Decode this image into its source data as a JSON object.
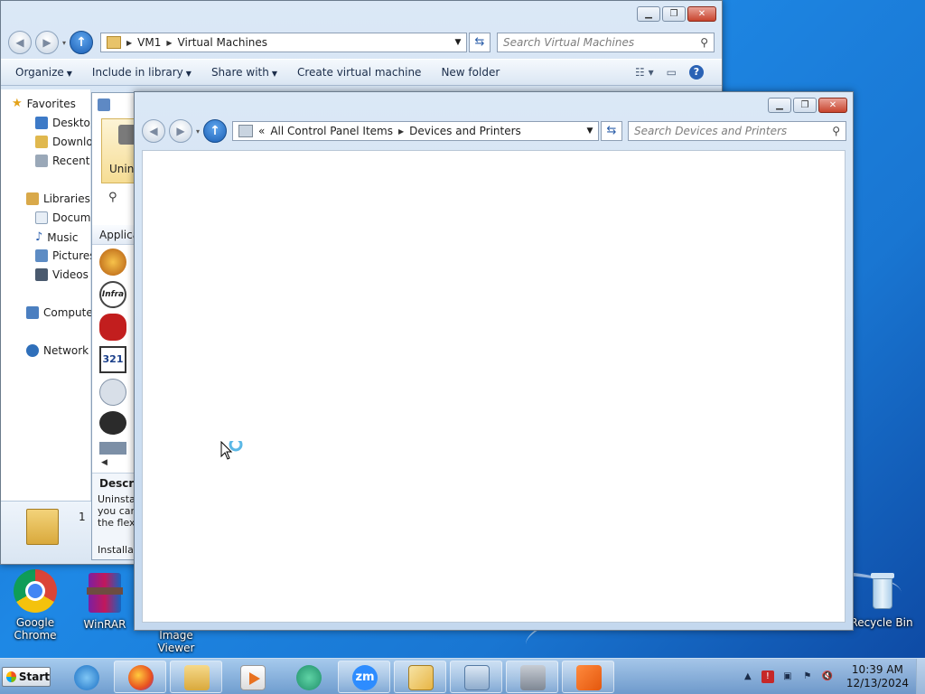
{
  "explorer": {
    "breadcrumb": [
      "VM1",
      "Virtual Machines"
    ],
    "search_placeholder": "Search Virtual Machines",
    "toolbar": {
      "organize": "Organize",
      "include_in_library": "Include in library",
      "share_with": "Share with",
      "create_vm": "Create virtual machine",
      "new_folder": "New folder"
    },
    "nav": {
      "favorites": "Favorites",
      "desktop": "Desktop",
      "downloads": "Downlo",
      "recent": "Recent P",
      "libraries": "Libraries",
      "documents": "Docume",
      "music": "Music",
      "pictures": "Pictures",
      "videos": "Videos",
      "computer": "Compute",
      "network": "Network"
    },
    "detail_count": "1"
  },
  "middle": {
    "uninstall": "Unins",
    "apps_header": "Applica",
    "description_header": "Descri",
    "desc_lines": [
      "Uninstall",
      "you can",
      "the flexi"
    ],
    "installed": "Installa"
  },
  "devices": {
    "breadcrumb": [
      "All Control Panel Items",
      "Devices and Printers"
    ],
    "breadcrumb_prefix": "«",
    "search_placeholder": "Search Devices and Printers"
  },
  "desktop_icons": {
    "chrome": "Google Chrome",
    "winrar": "WinRAR",
    "image_viewer": "Image Viewer",
    "recycle_bin": "Recycle Bin"
  },
  "taskbar": {
    "start": "Start",
    "time": "10:39 AM",
    "date": "12/13/2024",
    "apps": [
      "internet-explorer",
      "firefox",
      "file-explorer",
      "media-player",
      "browser",
      "zoom",
      "paint",
      "control-panel",
      "uninstaller",
      "app"
    ]
  }
}
